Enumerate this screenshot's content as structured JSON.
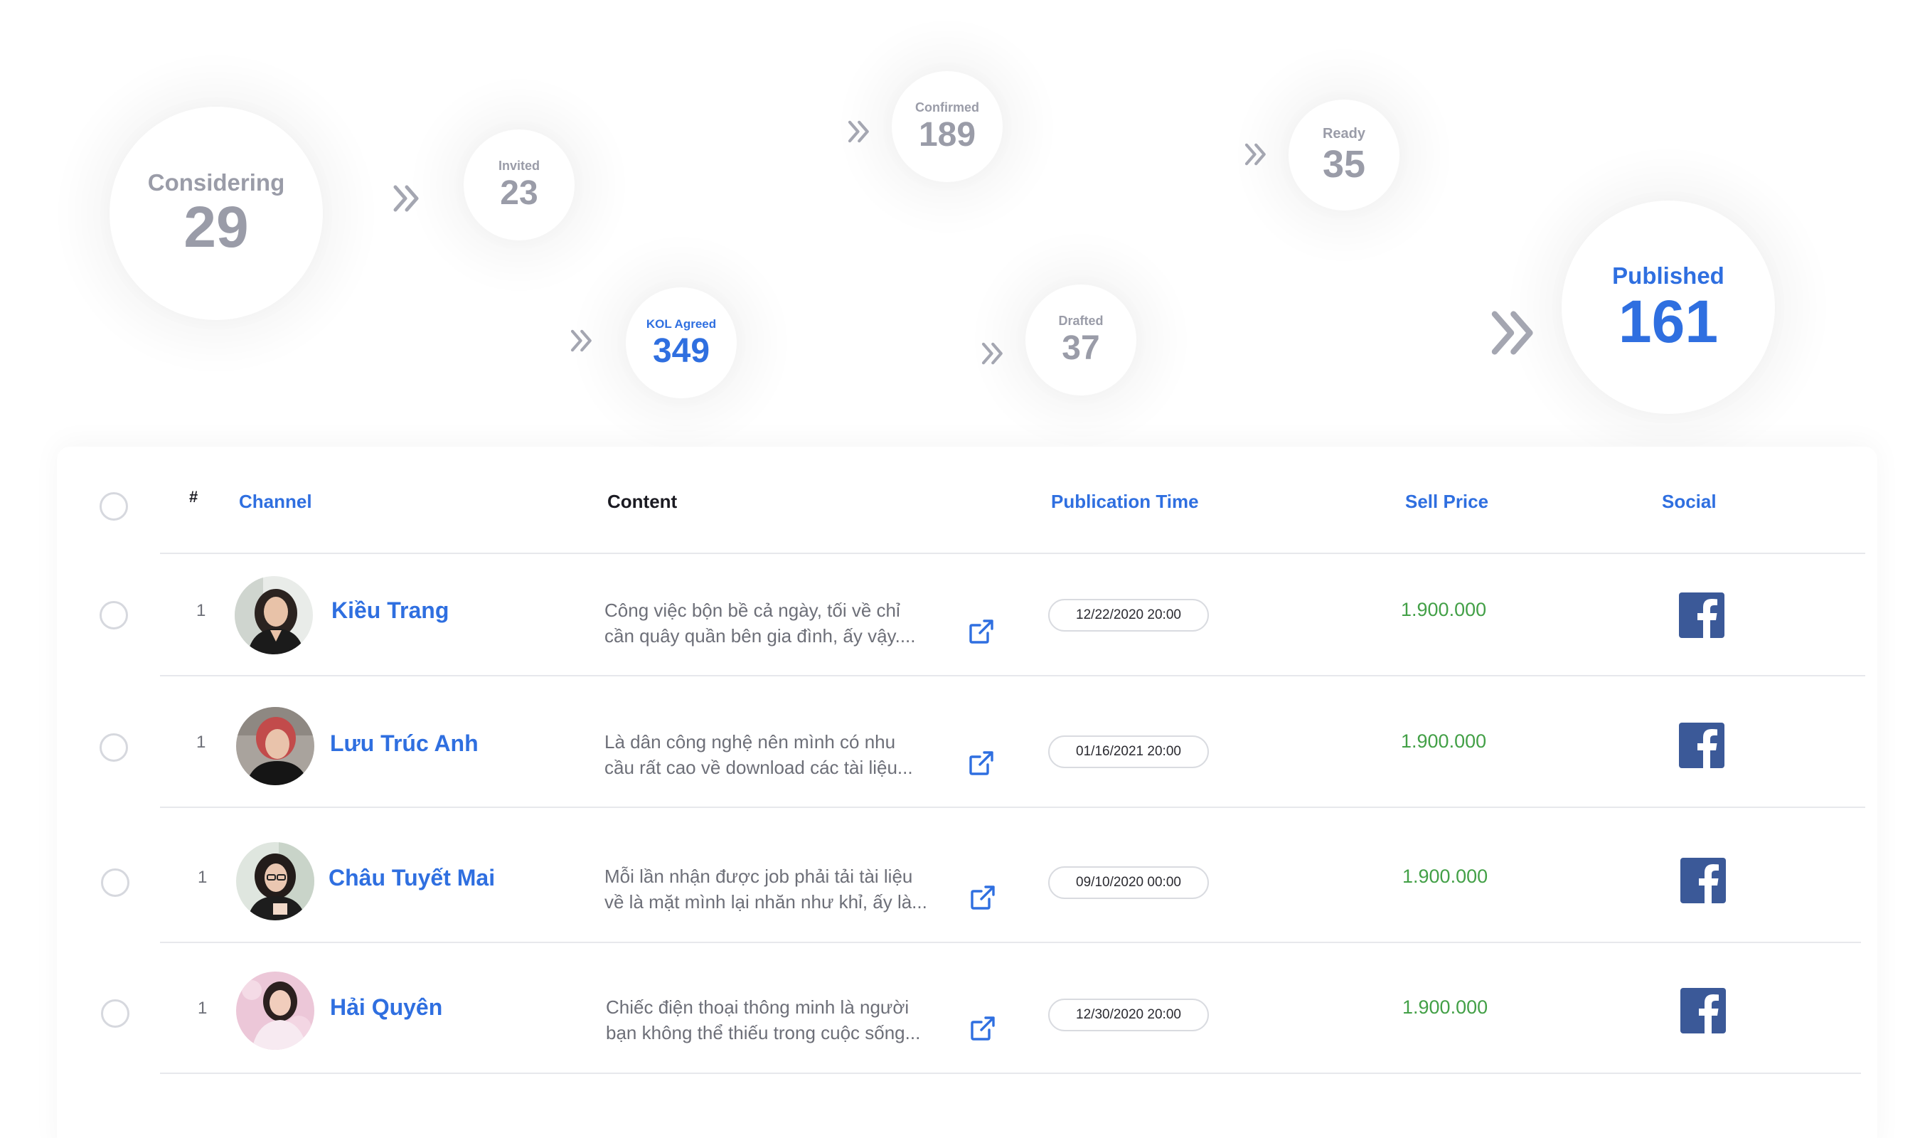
{
  "funnel": [
    {
      "label": "Considering",
      "value": "29"
    },
    {
      "label": "Invited",
      "value": "23"
    },
    {
      "label": "KOL Agreed",
      "value": "349"
    },
    {
      "label": "Confirmed",
      "value": "189"
    },
    {
      "label": "Drafted",
      "value": "37"
    },
    {
      "label": "Ready",
      "value": "35"
    },
    {
      "label": "Published",
      "value": "161"
    }
  ],
  "table": {
    "headers": {
      "index": "#",
      "channel": "Channel",
      "content": "Content",
      "publication_time": "Publication Time",
      "sell_price": "Sell Price",
      "social": "Social"
    },
    "rows": [
      {
        "index": "1",
        "channel": "Kiều Trang",
        "content_line1": "Công việc bộn bề cả ngày, tối về chỉ",
        "content_line2": "cần quây quần bên gia đình, ấy vậy....",
        "publication_time": "12/22/2020 20:00",
        "sell_price": "1.900.000",
        "social": "facebook-icon"
      },
      {
        "index": "1",
        "channel": "Lưu Trúc Anh",
        "content_line1": "Là dân công nghệ nên mình có nhu",
        "content_line2": "cầu rất cao về download các tài liệu...",
        "publication_time": "01/16/2021 20:00",
        "sell_price": "1.900.000",
        "social": "facebook-icon"
      },
      {
        "index": "1",
        "channel": "Châu Tuyết Mai",
        "content_line1": "Mỗi lần nhận được job phải tải tài liệu",
        "content_line2": "về là mặt mình lại nhăn như khỉ, ấy là...",
        "publication_time": "09/10/2020 00:00",
        "sell_price": "1.900.000",
        "social": "facebook-icon"
      },
      {
        "index": "1",
        "channel": "Hải Quyên",
        "content_line1": "Chiếc điện thoại thông minh là người",
        "content_line2": "bạn không thể thiếu trong cuộc sống...",
        "publication_time": "12/30/2020 20:00",
        "sell_price": "1.900.000",
        "social": "facebook-icon"
      }
    ]
  },
  "colors": {
    "accent_blue": "#2f6fe0",
    "muted_gray": "#9a9ca8",
    "price_green": "#43a047",
    "facebook_blue": "#3b5998"
  }
}
